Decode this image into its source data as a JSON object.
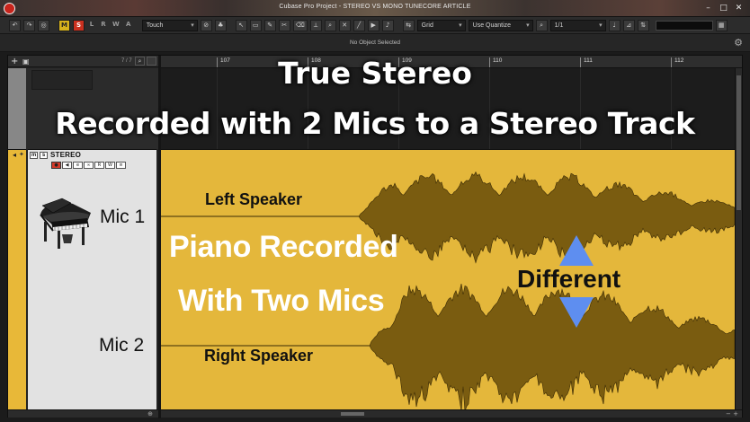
{
  "window": {
    "title": "Cubase Pro Project - STEREO VS MONO TUNECORE ARTICLE",
    "controls": [
      "–",
      "□",
      "✕"
    ]
  },
  "toolbar": {
    "m_label": "M",
    "s_label": "S",
    "letters": [
      "L",
      "R",
      "W",
      "A"
    ],
    "automation_mode": "Touch",
    "snap_type": "Grid",
    "quantize": "Use Quantize",
    "quantize_value": "1/1"
  },
  "infoline": {
    "text": "No Object Selected"
  },
  "track_list": {
    "count": "7 / 7",
    "track": {
      "name": "STEREO",
      "mute_label": "m",
      "solo_label": "s",
      "mini_buttons": [
        "●",
        "◀",
        "e",
        "∞",
        "R",
        "W",
        "≡"
      ]
    }
  },
  "ruler": {
    "bars": [
      "107",
      "108",
      "109",
      "110",
      "111",
      "112"
    ]
  },
  "captions": {
    "title_line1": "True Stereo",
    "title_line2": "Recorded with 2 Mics to a Stereo Track",
    "mic1": "Mic 1",
    "mic2": "Mic 2",
    "left_speaker": "Left Speaker",
    "right_speaker": "Right Speaker",
    "piano_line1": "Piano Recorded",
    "piano_line2": "With Two Mics",
    "different": "Different"
  },
  "colors": {
    "event_bg": "#e4b73b",
    "waveform": "#7a5c10",
    "arrow": "#5e8ef0",
    "solo_red": "#c9301f",
    "mute_yellow": "#d6b21c"
  },
  "icons": [
    "undo-icon",
    "redo-icon",
    "constrain-icon",
    "piano-icon",
    "arrow-up-icon",
    "arrow-down-icon",
    "gear-icon"
  ]
}
